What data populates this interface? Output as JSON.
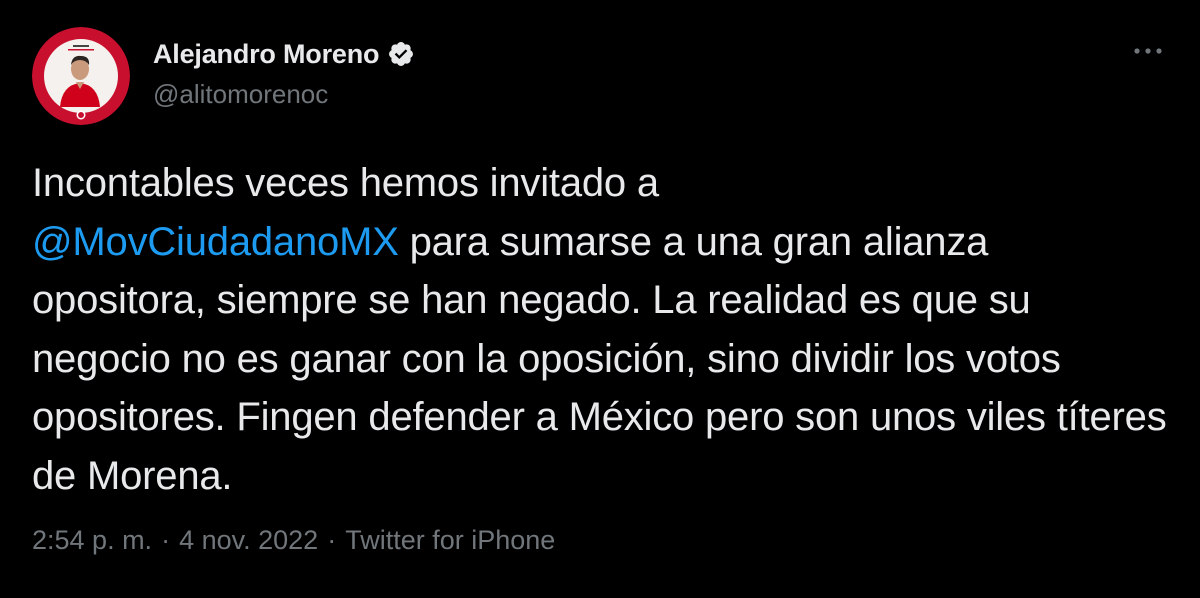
{
  "author": {
    "display_name": "Alejandro Moreno",
    "handle": "@alitomorenoc",
    "verified": true,
    "avatar": {
      "ring_color": "#c8102e",
      "background_color": "#ffffff"
    }
  },
  "menu": {
    "icon": "more-horizontal-icon"
  },
  "tweet": {
    "segments": [
      {
        "type": "text",
        "text": "Incontables veces hemos invitado a\n"
      },
      {
        "type": "mention",
        "text": "@MovCiudadanoMX"
      },
      {
        "type": "text",
        "text": " para sumarse a una gran alianza opositora, siempre se han negado. La realidad es que su negocio no es ganar con la oposición, sino dividir los votos opositores. Fingen defender a México pero son unos viles títeres de Morena."
      }
    ]
  },
  "meta": {
    "time": "2:54 p. m.",
    "separator": "·",
    "date": "4 nov. 2022",
    "source": "Twitter for iPhone"
  },
  "colors": {
    "background": "#000000",
    "text": "#e7e9ea",
    "secondary": "#71767b",
    "link": "#1d9bf0"
  }
}
